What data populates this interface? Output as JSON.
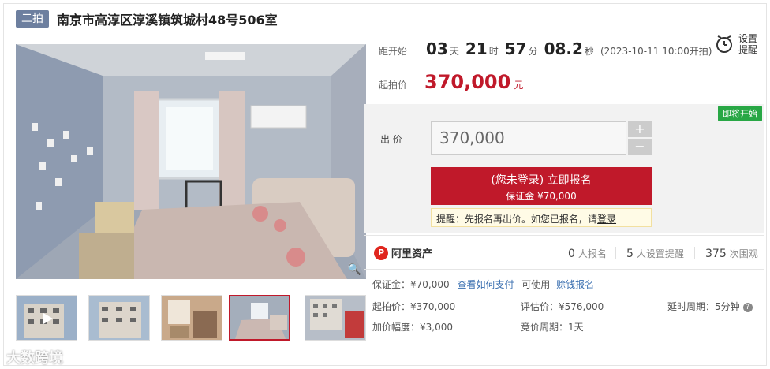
{
  "header": {
    "round_badge": "二拍",
    "title": "南京市高淳区淳溪镇筑城村48号506室"
  },
  "countdown": {
    "label": "距开始",
    "days": "03",
    "days_unit": "天",
    "hours": "21",
    "hours_unit": "时",
    "minutes": "57",
    "minutes_unit": "分",
    "seconds": "08.2",
    "seconds_unit": "秒",
    "start_note": "(2023-10-11 10:00开拍)"
  },
  "remind": {
    "line1": "设置",
    "line2": "提醒",
    "icon": "alarm-clock-icon"
  },
  "start_price": {
    "label": "起拍价",
    "value": "370,000",
    "unit": "元"
  },
  "bid": {
    "status_badge": "即将开始",
    "label": "出  价",
    "input_value": "370,000",
    "plus": "+",
    "minus": "−",
    "register_line1": "(您未登录) 立即报名",
    "register_line2": "保证金 ¥70,000",
    "tip_text": "提醒：先报名再出价。如您已报名，请",
    "tip_link": "登录"
  },
  "stats": {
    "logo_text": "阿里资产",
    "registered_count": "0",
    "registered_label": "人报名",
    "remind_count": "5",
    "remind_label": "人设置提醒",
    "view_count": "375",
    "view_label": "次围观"
  },
  "details": {
    "deposit": "保证金：¥70,000",
    "how_to_pay": "查看如何支付",
    "usable": "可使用",
    "loan_register": "赊钱报名",
    "start_price": "起拍价：¥370,000",
    "appraisal": "评估价：¥576,000",
    "delay_period": "延时周期：5分钟",
    "increment": "加价幅度：¥3,000",
    "auction_period": "竞价周期：1天"
  },
  "watermark": "大数跨境",
  "colors": {
    "accent_red": "#c0192a",
    "badge_blue": "#6d7f9f",
    "status_green": "#28a745",
    "link_blue": "#3a6fb0"
  }
}
